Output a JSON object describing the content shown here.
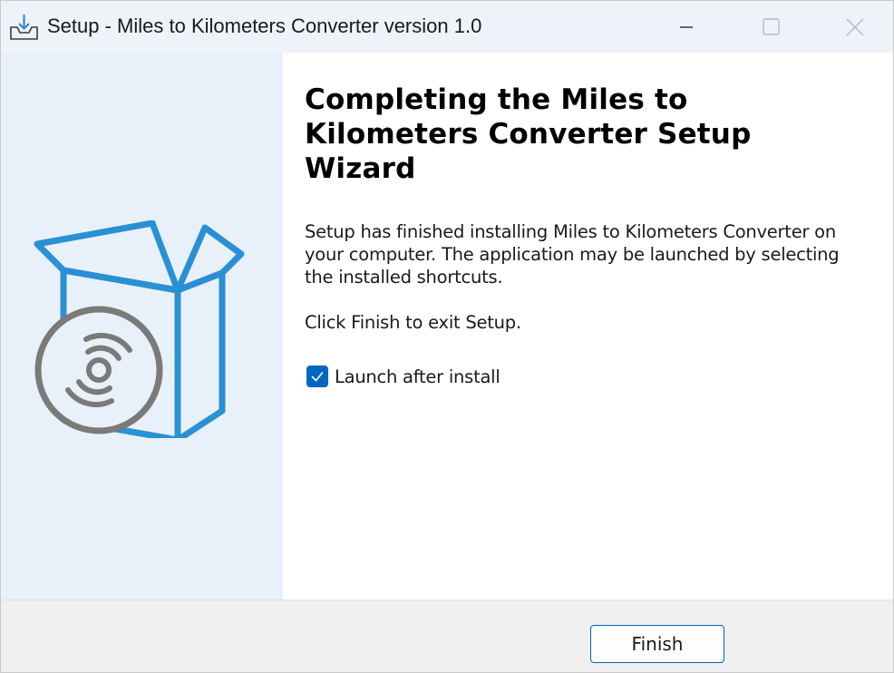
{
  "window": {
    "title": "Setup - Miles to Kilometers Converter version 1.0",
    "controls": {
      "minimize": "minimize-icon",
      "maximize": "maximize-icon",
      "close": "close-icon"
    }
  },
  "sidebar": {
    "illustration": "software-box-with-disc"
  },
  "main": {
    "heading": "Completing the Miles to Kilometers Converter Setup Wizard",
    "description": "Setup has finished installing Miles to Kilometers Converter on your computer. The application may be launched by selecting the installed shortcuts.",
    "exit_instruction": "Click Finish to exit Setup.",
    "launch_checkbox": {
      "label": "Launch after install",
      "checked": true
    }
  },
  "footer": {
    "finish_label": "Finish"
  },
  "colors": {
    "accent": "#0067c0",
    "sidebar_bg": "#e8f1f9",
    "titlebar_bg": "#eef3f9",
    "box_blue": "#2a90d4",
    "disc_gray": "#7a7a7a"
  }
}
